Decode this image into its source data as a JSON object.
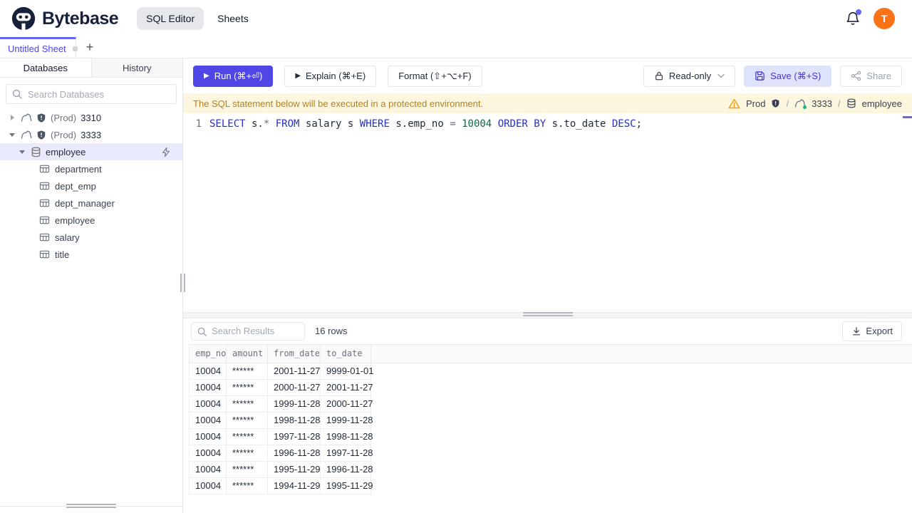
{
  "header": {
    "brand": "Bytebase",
    "nav_sql_editor": "SQL Editor",
    "nav_sheets": "Sheets",
    "avatar_initial": "T"
  },
  "tabbar": {
    "active_tab": "Untitled Sheet",
    "add_button": "+"
  },
  "sidebar": {
    "tab_databases": "Databases",
    "tab_history": "History",
    "search_placeholder": "Search Databases",
    "instances": [
      {
        "env": "(Prod)",
        "name": "3310"
      },
      {
        "env": "(Prod)",
        "name": "3333"
      }
    ],
    "database": "employee",
    "tables": [
      "department",
      "dept_emp",
      "dept_manager",
      "employee",
      "salary",
      "title"
    ]
  },
  "toolbar": {
    "run": "Run (⌘+⏎)",
    "explain": "Explain (⌘+E)",
    "format": "Format (⇧+⌥+F)",
    "readonly": "Read-only",
    "save": "Save (⌘+S)",
    "share": "Share"
  },
  "banner": {
    "message": "The SQL statement below will be executed in a protected environment.",
    "env": "Prod",
    "separator": "/",
    "instance": "3333",
    "database": "employee"
  },
  "editor": {
    "line_number": "1",
    "tokens": [
      {
        "text": "SELECT",
        "type": "kw"
      },
      {
        "text": " s.",
        "type": "id"
      },
      {
        "text": "*",
        "type": "op"
      },
      {
        "text": " ",
        "type": "id"
      },
      {
        "text": "FROM",
        "type": "kw"
      },
      {
        "text": " salary s ",
        "type": "id"
      },
      {
        "text": "WHERE",
        "type": "kw"
      },
      {
        "text": " s.emp_no ",
        "type": "id"
      },
      {
        "text": "=",
        "type": "op"
      },
      {
        "text": " ",
        "type": "id"
      },
      {
        "text": "10004",
        "type": "num"
      },
      {
        "text": " ",
        "type": "id"
      },
      {
        "text": "ORDER",
        "type": "kw"
      },
      {
        "text": " ",
        "type": "id"
      },
      {
        "text": "BY",
        "type": "kw"
      },
      {
        "text": " s.to_date ",
        "type": "id"
      },
      {
        "text": "DESC",
        "type": "kw"
      },
      {
        "text": ";",
        "type": "id"
      }
    ]
  },
  "results": {
    "search_placeholder": "Search Results",
    "row_count": "16 rows",
    "export": "Export",
    "columns": [
      "emp_no",
      "amount",
      "from_date",
      "to_date"
    ],
    "rows": [
      [
        "10004",
        "******",
        "2001-11-27",
        "9999-01-01"
      ],
      [
        "10004",
        "******",
        "2000-11-27",
        "2001-11-27"
      ],
      [
        "10004",
        "******",
        "1999-11-28",
        "2000-11-27"
      ],
      [
        "10004",
        "******",
        "1998-11-28",
        "1999-11-28"
      ],
      [
        "10004",
        "******",
        "1997-11-28",
        "1998-11-28"
      ],
      [
        "10004",
        "******",
        "1996-11-28",
        "1997-11-28"
      ],
      [
        "10004",
        "******",
        "1995-11-29",
        "1996-11-28"
      ],
      [
        "10004",
        "******",
        "1994-11-29",
        "1995-11-29"
      ]
    ]
  },
  "colors": {
    "accent": "#4f46e5",
    "warning_bg": "#fdf6df",
    "warning_text": "#b7801c",
    "avatar": "#f97316",
    "keyword": "#2430c3",
    "number": "#116644"
  }
}
